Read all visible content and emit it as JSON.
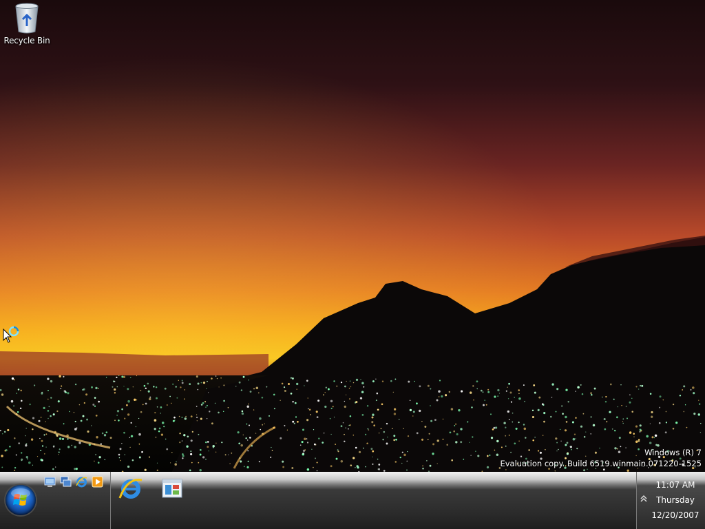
{
  "desktop": {
    "icons": [
      {
        "label": "Recycle Bin",
        "icon": "recycle-bin-icon"
      }
    ]
  },
  "watermark": {
    "line1": "Windows (R) 7",
    "line2": "Evaluation copy. Build 6519.winmain.071220-1525"
  },
  "taskbar": {
    "start_icon": "windows-start-orb-icon",
    "quick_launch": [
      {
        "icon": "show-desktop-icon"
      },
      {
        "icon": "switch-windows-icon"
      },
      {
        "icon": "internet-explorer-icon"
      },
      {
        "icon": "media-player-icon"
      }
    ],
    "tasks": [
      {
        "icon": "internet-explorer-icon"
      },
      {
        "icon": "windows-explorer-icon"
      }
    ],
    "tray": {
      "chevron_icon": "show-hidden-icons-chevron-icon",
      "time": "11:07 AM",
      "day": "Thursday",
      "date": "12/20/2007"
    }
  },
  "colors": {
    "sky_top": "#1a0a0c",
    "sky_glow": "#f5c21a",
    "taskbar": "#2b2b2b",
    "city_lights": "#7dffb0"
  }
}
